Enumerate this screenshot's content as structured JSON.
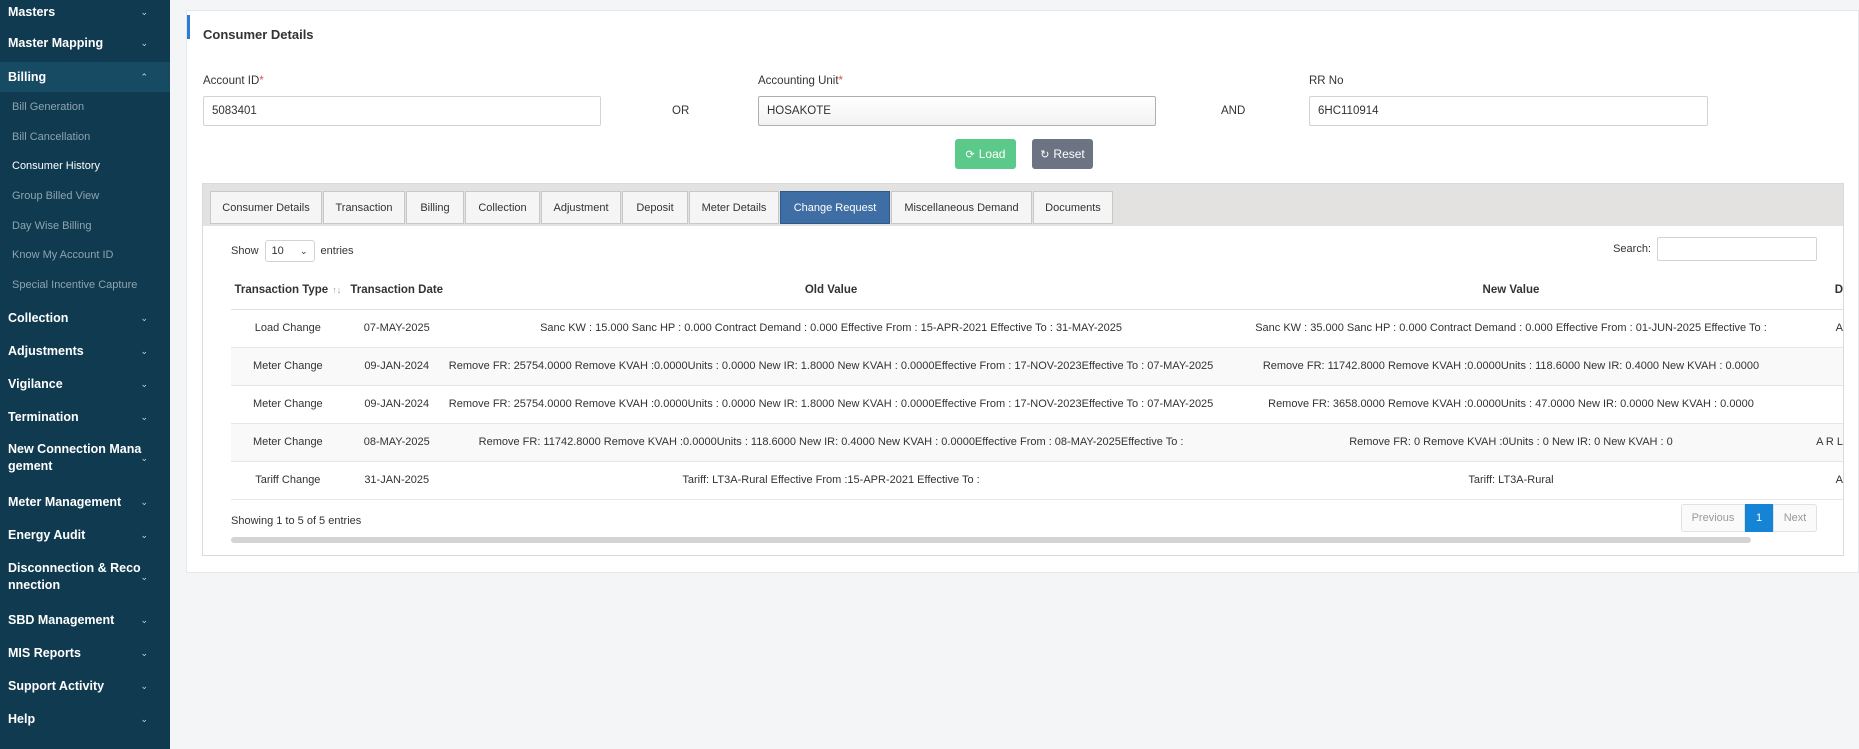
{
  "sidebar": {
    "items": [
      {
        "label": "Masters",
        "chevron": "down"
      },
      {
        "label": "Master Mapping",
        "chevron": "down"
      },
      {
        "label": "Billing",
        "chevron": "up"
      },
      {
        "label": "Collection",
        "chevron": "down"
      },
      {
        "label": "Adjustments",
        "chevron": "down"
      },
      {
        "label": "Vigilance",
        "chevron": "down"
      },
      {
        "label": "Termination",
        "chevron": "down"
      },
      {
        "label": "New Connection Management",
        "chevron": "down"
      },
      {
        "label": "Meter Management",
        "chevron": "down"
      },
      {
        "label": "Energy Audit",
        "chevron": "down"
      },
      {
        "label": "Disconnection & Reconnection",
        "chevron": "down"
      },
      {
        "label": "SBD Management",
        "chevron": "down"
      },
      {
        "label": "MIS Reports",
        "chevron": "down"
      },
      {
        "label": "Support Activity",
        "chevron": "down"
      },
      {
        "label": "Help",
        "chevron": "down"
      }
    ],
    "billing_sub": [
      "Bill Generation",
      "Bill Cancellation",
      "Consumer History",
      "Group Billed View",
      "Day Wise Billing",
      "Know My Account ID",
      "Special Incentive Capture"
    ]
  },
  "panel": {
    "title": "Consumer Details",
    "account_id_label": "Account ID",
    "account_id_value": "5083401",
    "or_text": "OR",
    "accounting_unit_label": "Accounting Unit",
    "accounting_unit_value": "HOSAKOTE",
    "and_text": "AND",
    "rr_no_label": "RR No",
    "rr_no_value": "6HC110914",
    "required_mark": "*",
    "load_label": "Load",
    "reset_label": "Reset"
  },
  "tabs": [
    "Consumer Details",
    "Transaction",
    "Billing",
    "Collection",
    "Adjustment",
    "Deposit",
    "Meter Details",
    "Change Request",
    "Miscellaneous Demand",
    "Documents"
  ],
  "active_tab": "Change Request",
  "table": {
    "show_text": "Show",
    "page_size": "10",
    "entries_text": "entries",
    "search_label": "Search:",
    "columns": [
      "Transaction Type",
      "Transaction Date",
      "Old Value",
      "New Value",
      "D"
    ],
    "rows": [
      {
        "type": "Load Change",
        "date": "07-MAY-2025",
        "old": "Sanc KW : 15.000 Sanc HP : 0.000 Contract Demand : 0.000 Effective From : 15-APR-2021 Effective To : 31-MAY-2025",
        "new": "Sanc KW : 35.000 Sanc HP : 0.000 Contract Demand : 0.000 Effective From : 01-JUN-2025 Effective To :",
        "extra": "A"
      },
      {
        "type": "Meter Change",
        "date": "09-JAN-2024",
        "old": "Remove FR: 25754.0000 Remove KVAH :0.0000Units : 0.0000 New IR: 1.8000 New KVAH : 0.0000Effective From : 17-NOV-2023Effective To : 07-MAY-2025",
        "new": "Remove FR: 11742.8000 Remove KVAH :0.0000Units : 118.6000 New IR: 0.4000 New KVAH : 0.0000",
        "extra": ""
      },
      {
        "type": "Meter Change",
        "date": "09-JAN-2024",
        "old": "Remove FR: 25754.0000 Remove KVAH :0.0000Units : 0.0000 New IR: 1.8000 New KVAH : 0.0000Effective From : 17-NOV-2023Effective To : 07-MAY-2025",
        "new": "Remove FR: 3658.0000 Remove KVAH :0.0000Units : 47.0000 New IR: 0.0000 New KVAH : 0.0000",
        "extra": ""
      },
      {
        "type": "Meter Change",
        "date": "08-MAY-2025",
        "old": "Remove FR: 11742.8000 Remove KVAH :0.0000Units : 118.6000 New IR: 0.4000 New KVAH : 0.0000Effective From : 08-MAY-2025Effective To :",
        "new": "Remove FR: 0 Remove KVAH :0Units : 0 New IR: 0 New KVAH : 0",
        "extra": "A R L"
      },
      {
        "type": "Tariff Change",
        "date": "31-JAN-2025",
        "old": "Tariff: LT3A-Rural Effective From :15-APR-2021 Effective To :",
        "new": "Tariff: LT3A-Rural",
        "extra": "A"
      }
    ],
    "info": "Showing 1 to 5 of 5 entries",
    "pager": {
      "previous": "Previous",
      "current": "1",
      "next": "Next"
    }
  },
  "colors": {
    "sidebar_bg": "#0f3a4f",
    "active_tab": "#3e6ea3",
    "load_button": "#5bc98a",
    "reset_button": "#6c7382",
    "page_current": "#1583d6"
  }
}
